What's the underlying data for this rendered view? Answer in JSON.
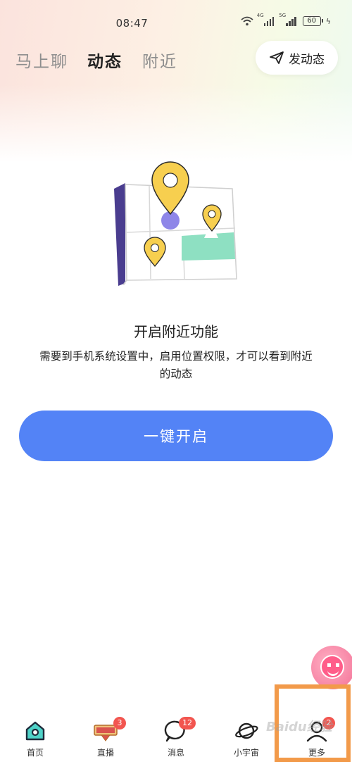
{
  "status_bar": {
    "time": "08:47",
    "sim1_tag": "4G",
    "sim2_tag": "5G",
    "battery": "60"
  },
  "top_nav": {
    "tabs": [
      {
        "label": "马上聊",
        "active": false
      },
      {
        "label": "动态",
        "active": true
      },
      {
        "label": "附近",
        "active": false
      }
    ],
    "post_button": "发动态"
  },
  "feature": {
    "title": "开启附近功能",
    "description": "需要到手机系统设置中，启用位置权限，才可以看到附近的动态",
    "enable_button": "一键开启"
  },
  "bottom_nav": {
    "items": [
      {
        "label": "首页",
        "icon": "home-icon",
        "badge": ""
      },
      {
        "label": "直播",
        "icon": "live-icon",
        "badge": "3"
      },
      {
        "label": "消息",
        "icon": "message-icon",
        "badge": "12"
      },
      {
        "label": "小宇宙",
        "icon": "planet-icon",
        "badge": ""
      },
      {
        "label": "更多",
        "icon": "person-icon",
        "badge": "2"
      }
    ]
  },
  "watermark": "Baidu经验",
  "colors": {
    "accent": "#5383f6",
    "badge": "#f2554f",
    "highlight": "#f29a4a",
    "pin_yellow": "#f7cf4f",
    "map_green": "#8ee0c2",
    "map_purple": "#4a3d8f"
  }
}
